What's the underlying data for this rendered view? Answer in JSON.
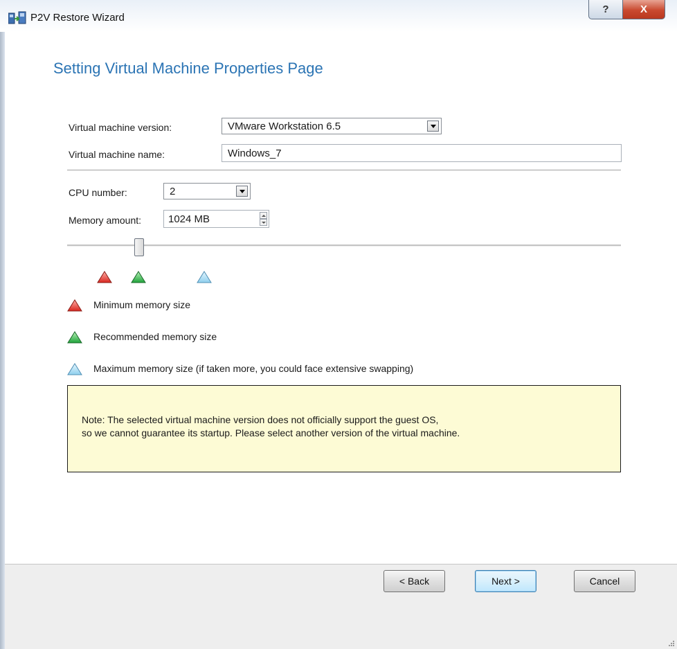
{
  "window": {
    "title": "P2V Restore Wizard",
    "help_label": "?",
    "close_label": "X"
  },
  "page": {
    "title": "Setting Virtual Machine Properties Page"
  },
  "form": {
    "vm_version_label": "Virtual machine version:",
    "vm_version_value": "VMware Workstation 6.5",
    "vm_name_label": "Virtual machine name:",
    "vm_name_value": "Windows_7",
    "cpu_label": "CPU number:",
    "cpu_value": "2",
    "memory_label": "Memory amount:",
    "memory_value": "1024 MB"
  },
  "slider": {
    "fraction": 0.13
  },
  "legend": {
    "min_label": "Minimum memory size",
    "rec_label": "Recommended memory size",
    "max_label": "Maximum memory size (if taken more, you could face extensive swapping)"
  },
  "colors": {
    "min": "#e23a3a",
    "rec": "#2db84a",
    "max": "#9fd6f0",
    "accent": "#2b74b4",
    "note_bg": "#fdfbd5"
  },
  "note": {
    "text": "Note: The selected virtual machine version does not officially support the guest OS,\nso we cannot guarantee its startup. Please select another version of the virtual machine."
  },
  "buttons": {
    "back": "< Back",
    "next": "Next >",
    "cancel": "Cancel"
  }
}
